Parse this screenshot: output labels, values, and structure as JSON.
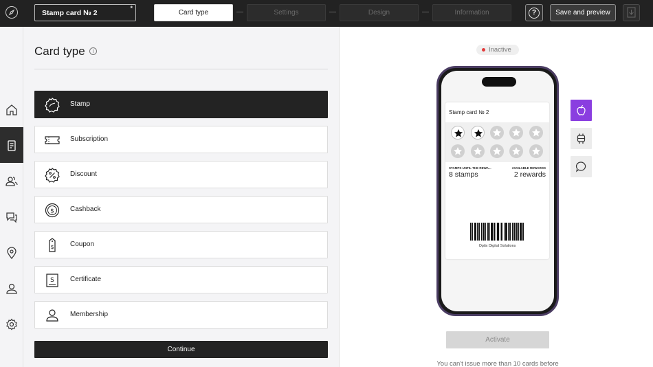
{
  "header": {
    "card_name": "Stamp card № 2",
    "steps": [
      {
        "label": "Card type",
        "active": true
      },
      {
        "label": "Settings",
        "active": false
      },
      {
        "label": "Design",
        "active": false
      },
      {
        "label": "Information",
        "active": false
      }
    ],
    "help_label": "?",
    "save_label": "Save and preview"
  },
  "sidebar": {
    "items": [
      {
        "icon": "home-icon",
        "active": false
      },
      {
        "icon": "cards-icon",
        "active": true
      },
      {
        "icon": "clients-icon",
        "active": false
      },
      {
        "icon": "chat-icon",
        "active": false
      },
      {
        "icon": "location-icon",
        "active": false
      },
      {
        "icon": "user-icon",
        "active": false
      },
      {
        "icon": "settings-icon",
        "active": false
      }
    ]
  },
  "card_type_panel": {
    "title": "Card type",
    "info_icon": "i",
    "types": [
      {
        "label": "Stamp",
        "icon": "stamp-icon",
        "selected": true
      },
      {
        "label": "Subscription",
        "icon": "ticket-icon",
        "selected": false
      },
      {
        "label": "Discount",
        "icon": "discount-icon",
        "selected": false
      },
      {
        "label": "Cashback",
        "icon": "cashback-icon",
        "selected": false
      },
      {
        "label": "Coupon",
        "icon": "coupon-icon",
        "selected": false
      },
      {
        "label": "Certificate",
        "icon": "certificate-icon",
        "selected": false
      },
      {
        "label": "Membership",
        "icon": "membership-icon",
        "selected": false
      }
    ],
    "continue_label": "Continue"
  },
  "preview": {
    "status": "Inactive",
    "status_color": "#e23b3b",
    "card": {
      "title": "Stamp card № 2",
      "stamps_total": 10,
      "stamps_filled": 2,
      "field1_label": "STAMPS UNTIL THE REWA...",
      "field1_value": "8 stamps",
      "field2_label": "AVAILABLE REWARDS",
      "field2_value": "2 rewards",
      "company": "Optix Digital Solutions"
    },
    "platforms": [
      {
        "icon": "apple-icon",
        "active": true
      },
      {
        "icon": "android-icon",
        "active": false
      },
      {
        "icon": "message-icon",
        "active": false
      }
    ],
    "activate_label": "Activate",
    "notice": "You can't issue more than 10 cards before",
    "accent_color": "#8a3ee0"
  }
}
